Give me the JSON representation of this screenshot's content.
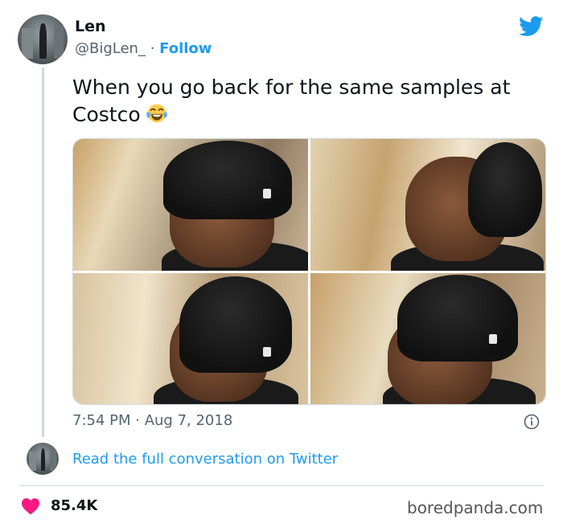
{
  "author": {
    "name": "Len",
    "handle": "@BigLen_",
    "separator": " · ",
    "follow_label": "Follow"
  },
  "tweet": {
    "text": "When you go back for the same samples at Costco",
    "emoji": "face-with-tears-of-joy"
  },
  "media": {
    "panels": [
      "panel-1",
      "panel-2",
      "panel-3",
      "panel-4"
    ]
  },
  "meta": {
    "time": "7:54 PM",
    "dot": " · ",
    "date": "Aug 7, 2018"
  },
  "conversation_link": "Read the full conversation on Twitter",
  "likes": "85.4K",
  "watermark": "boredpanda.com",
  "colors": {
    "twitter_blue": "#1d9bf0",
    "heart": "#f91880",
    "text": "#0f1419",
    "muted": "#536471",
    "border": "#cfd9de"
  },
  "icons": {
    "brand": "twitter-bird-icon",
    "info": "info-icon",
    "like": "heart-icon"
  }
}
